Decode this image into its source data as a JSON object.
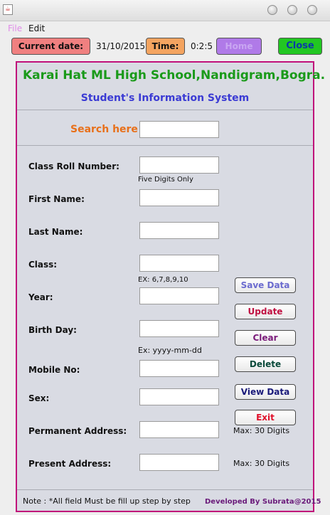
{
  "window": {
    "app_icon": "java-icon",
    "controls": [
      "minimize-icon",
      "maximize-icon",
      "close-icon"
    ]
  },
  "menu": {
    "file": "File",
    "edit": "Edit"
  },
  "toolbar": {
    "current_date_label": "Current date:",
    "current_date_value": "31/10/2015",
    "time_label": "Time:",
    "time_value": "0:2:5",
    "home_label": "Home",
    "close_label": "Close"
  },
  "header": {
    "school": "Karai Hat ML High School,Nandigram,Bogra.",
    "system": "Student's Information System"
  },
  "search": {
    "label": "Search here",
    "value": ""
  },
  "form": {
    "roll": {
      "label": "Class Roll Number:",
      "hint": "Five Digits Only",
      "value": ""
    },
    "first_name": {
      "label": "First Name:",
      "value": ""
    },
    "last_name": {
      "label": "Last Name:",
      "value": ""
    },
    "class": {
      "label": "Class:",
      "hint": "EX: 6,7,8,9,10",
      "value": ""
    },
    "year": {
      "label": "Year:",
      "value": ""
    },
    "birth_day": {
      "label": "Birth Day:",
      "hint": "Ex: yyyy-mm-dd",
      "value": ""
    },
    "mobile": {
      "label": "Mobile No:",
      "value": ""
    },
    "sex": {
      "label": "Sex:",
      "value": ""
    },
    "permanent_address": {
      "label": "Permanent Address:",
      "hint": "Max: 30 Digits",
      "value": ""
    },
    "present_address": {
      "label": "Present Address:",
      "hint": "Max: 30 Digits",
      "value": ""
    }
  },
  "actions": {
    "save": "Save Data",
    "update": "Update",
    "clear": "Clear",
    "delete": "Delete",
    "view": "View Data",
    "exit": "Exit"
  },
  "footer": {
    "note": "Note : *All field Must be fill up step by step",
    "credit": "Developed By Subrata@2015"
  },
  "colors": {
    "panel_border": "#c0107a",
    "school_title": "#1a9a1a",
    "subtitle": "#3b3bd4",
    "search_label": "#e8701a"
  }
}
